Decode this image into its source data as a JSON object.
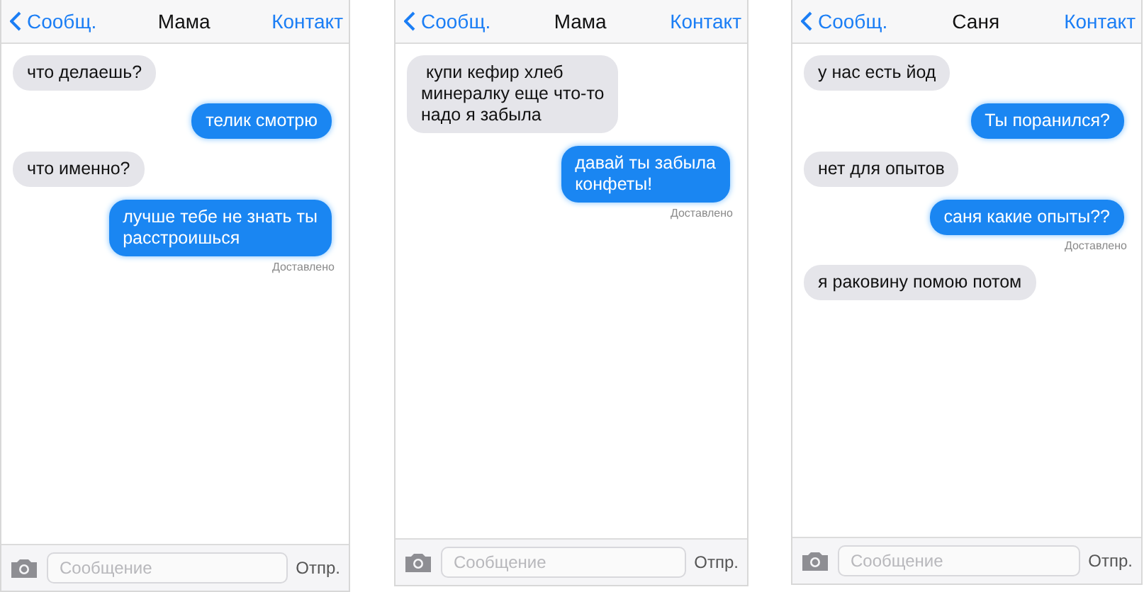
{
  "panels": [
    {
      "header": {
        "back": "Сообщ.",
        "title": "Мама",
        "action": "Контакт"
      },
      "messages": [
        {
          "kind": "incoming",
          "text": "что делаешь?"
        },
        {
          "kind": "outgoing",
          "text": "телик смотрю"
        },
        {
          "kind": "incoming",
          "text": "что именно?"
        },
        {
          "kind": "outgoing",
          "text": "лучше тебе не знать ты\nрасстроишься",
          "status": "Доставлено"
        }
      ],
      "composer": {
        "placeholder": "Сообщение",
        "send": "Отпр."
      }
    },
    {
      "header": {
        "back": "Сообщ.",
        "title": "Мама",
        "action": "Контакт"
      },
      "messages": [
        {
          "kind": "incoming",
          "text": " купи кефир хлеб\nминералку еще что-то\nнадо я забыла"
        },
        {
          "kind": "outgoing",
          "text": "давай ты забыла\nконфеты!",
          "status": "Доставлено"
        }
      ],
      "composer": {
        "placeholder": "Сообщение",
        "send": "Отпр."
      }
    },
    {
      "header": {
        "back": "Сообщ.",
        "title": "Саня",
        "action": "Контакт"
      },
      "messages": [
        {
          "kind": "incoming",
          "text": "у нас есть йод"
        },
        {
          "kind": "outgoing",
          "text": "Ты поранился?"
        },
        {
          "kind": "incoming",
          "text": "нет для опытов"
        },
        {
          "kind": "outgoing",
          "text": "саня какие опыты??",
          "status": "Доставлено"
        },
        {
          "kind": "incoming",
          "text": "я раковину помою потом"
        }
      ],
      "composer": {
        "placeholder": "Сообщение",
        "send": "Отпр."
      }
    }
  ]
}
